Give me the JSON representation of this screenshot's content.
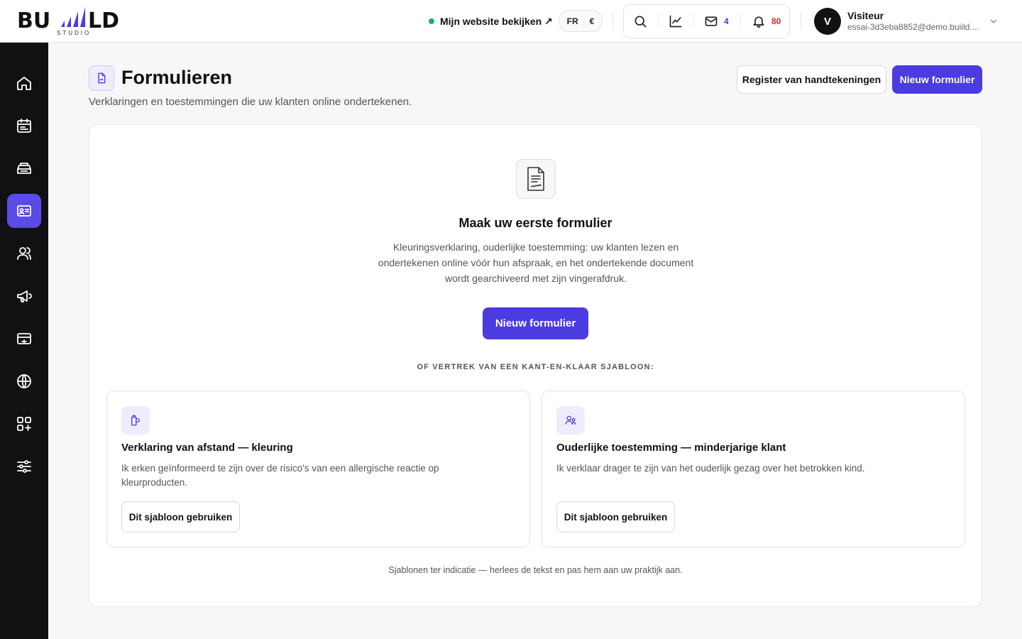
{
  "brand": {
    "logo_text": "BU LD",
    "logo_sub": "STUDIO"
  },
  "header": {
    "view_site": "Mijn website bekijken ↗",
    "lang": "FR",
    "currency": "€",
    "mail_count": "4",
    "notif_count": "80",
    "user": {
      "initial": "V",
      "name": "Visiteur",
      "email": "essai-3d3eba8852@demo.buiild...."
    }
  },
  "sidebar": {
    "items": [
      {
        "name": "home-icon",
        "active": false
      },
      {
        "name": "calendar-icon",
        "active": false
      },
      {
        "name": "inventory-icon",
        "active": false
      },
      {
        "name": "forms-icon",
        "active": true
      },
      {
        "name": "clients-icon",
        "active": false
      },
      {
        "name": "megaphone-icon",
        "active": false
      },
      {
        "name": "payment-icon",
        "active": false
      },
      {
        "name": "globe-icon",
        "active": false
      },
      {
        "name": "apps-icon",
        "active": false
      },
      {
        "name": "settings-sliders-icon",
        "active": false
      }
    ]
  },
  "page": {
    "title": "Formulieren",
    "subtitle": "Verklaringen en toestemmingen die uw klanten online ondertekenen.",
    "register_button": "Register van handtekeningen",
    "new_button": "Nieuw formulier"
  },
  "empty_state": {
    "title": "Maak uw eerste formulier",
    "description": "Kleuringsverklaring, ouderlijke toestemming: uw klanten lezen en ondertekenen online vóór hun afspraak, en het ondertekende document wordt gearchiveerd met zijn vingerafdruk.",
    "button": "Nieuw formulier",
    "or_label": "OF VERTREK VAN EEN KANT-EN-KLAAR SJABLOON:",
    "templates": [
      {
        "icon": "dye-bottle-icon",
        "title": "Verklaring van afstand — kleuring",
        "description": "Ik erken geïnformeerd te zijn over de risico's van een allergische reactie op kleurproducten.",
        "button": "Dit sjabloon gebruiken"
      },
      {
        "icon": "parent-child-icon",
        "title": "Ouderlijke toestemming — minderjarige klant",
        "description": "Ik verklaar drager te zijn van het ouderlijk gezag over het betrokken kind.",
        "button": "Dit sjabloon gebruiken"
      }
    ],
    "footnote": "Sjablonen ter indicatie — herlees de tekst en pas hem aan uw praktijk aan."
  },
  "colors": {
    "accent": "#4b3be0",
    "sidebar_bg": "#111113",
    "online": "#1fb155",
    "alert": "#d12a2a"
  }
}
